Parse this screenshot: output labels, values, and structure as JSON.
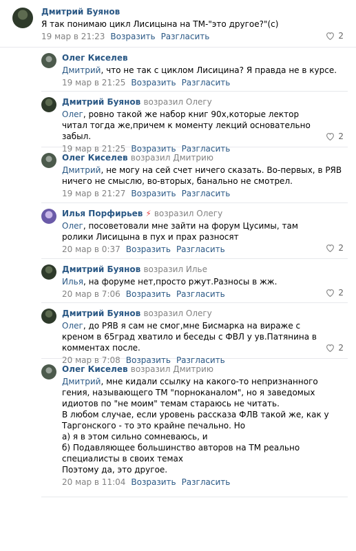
{
  "comments": [
    {
      "author": "Дмитрий Буянов",
      "replied_to": "",
      "reply_prefix": "",
      "text": "Я так понимаю цикл Лисицына на ТМ-\"это другое?\"(с)",
      "date": "19 мар в 21:23",
      "reply_label": "Возразить",
      "share_label": "Разгласить",
      "likes": "2"
    },
    {
      "author": "Олег Киселев",
      "replied_to": "",
      "reply_prefix": "Дмитрий",
      "text": ", что не так с циклом Лисицина? Я правда не в курсе.",
      "date": "19 мар в 21:25",
      "reply_label": "Возразить",
      "share_label": "Разгласить",
      "likes": ""
    },
    {
      "author": "Дмитрий Буянов",
      "replied_to": "возразил Олегу",
      "reply_prefix": "Олег",
      "text": ", ровно такой же набор книг 90х,которые лектор читал тогда же,причем к моменту лекций основательно забыл.",
      "date": "19 мар в 21:25",
      "reply_label": "Возразить",
      "share_label": "Разгласить",
      "likes": "2"
    },
    {
      "author": "Олег Киселев",
      "replied_to": "возразил Дмитрию",
      "reply_prefix": "Дмитрий",
      "text": ", не могу на сей счет ничего сказать. Во-первых, в РЯВ ничего не смыслю, во-вторых, банально не смотрел.",
      "date": "19 мар в 21:27",
      "reply_label": "Возразить",
      "share_label": "Разгласить",
      "likes": ""
    },
    {
      "author": "Илья Порфирьев",
      "replied_to": "возразил Олегу",
      "reply_prefix": "Олег",
      "text": ", посоветовали мне зайти на форум Цусимы, там ролики Лисицына в пух и прах разносят",
      "date": "20 мар в 0:37",
      "reply_label": "Возразить",
      "share_label": "Разгласить",
      "likes": "2"
    },
    {
      "author": "Дмитрий Буянов",
      "replied_to": "возразил Илье",
      "reply_prefix": "Илья",
      "text": ", на форуме нет,просто ржут.Разносы в жж.",
      "date": "20 мар в 7:06",
      "reply_label": "Возразить",
      "share_label": "Разгласить",
      "likes": "2"
    },
    {
      "author": "Дмитрий Буянов",
      "replied_to": "возразил Олегу",
      "reply_prefix": "Олег",
      "text": ", до РЯВ я сам не смог,мне Бисмарка на вираже с креном в 65град хватило и беседы с ФВЛ у ув.Патянина в комментах после.",
      "date": "20 мар в 7:08",
      "reply_label": "Возразить",
      "share_label": "Разгласить",
      "likes": "2"
    },
    {
      "author": "Олег Киселев",
      "replied_to": "возразил Дмитрию",
      "reply_prefix": "Дмитрий",
      "text_lines": [
        ", мне кидали ссылку на какого-то непризнанного гения, называющего ТМ \"порноканалом\", но я заведомых идиотов по \"не моим\" темам стараюсь не читать.",
        "В любом случае, если уровень рассказа ФЛВ такой же, как у Таргонского - то это крайне печально. Но",
        "а) я в этом сильно сомневаюсь, и",
        "б) Подавляющее большинство авторов на ТМ реально специалисты в своих темах",
        "Поэтому да, это другое."
      ],
      "date": "20 мар в 11:04",
      "reply_label": "Возразить",
      "share_label": "Разгласить",
      "likes": ""
    }
  ],
  "icons": {
    "heart": "heart-icon",
    "bolt": "lightning-icon"
  },
  "colors": {
    "link": "#2a5885",
    "meta": "#828282",
    "divider": "#e7e8ec",
    "bolt": "#e64646"
  }
}
